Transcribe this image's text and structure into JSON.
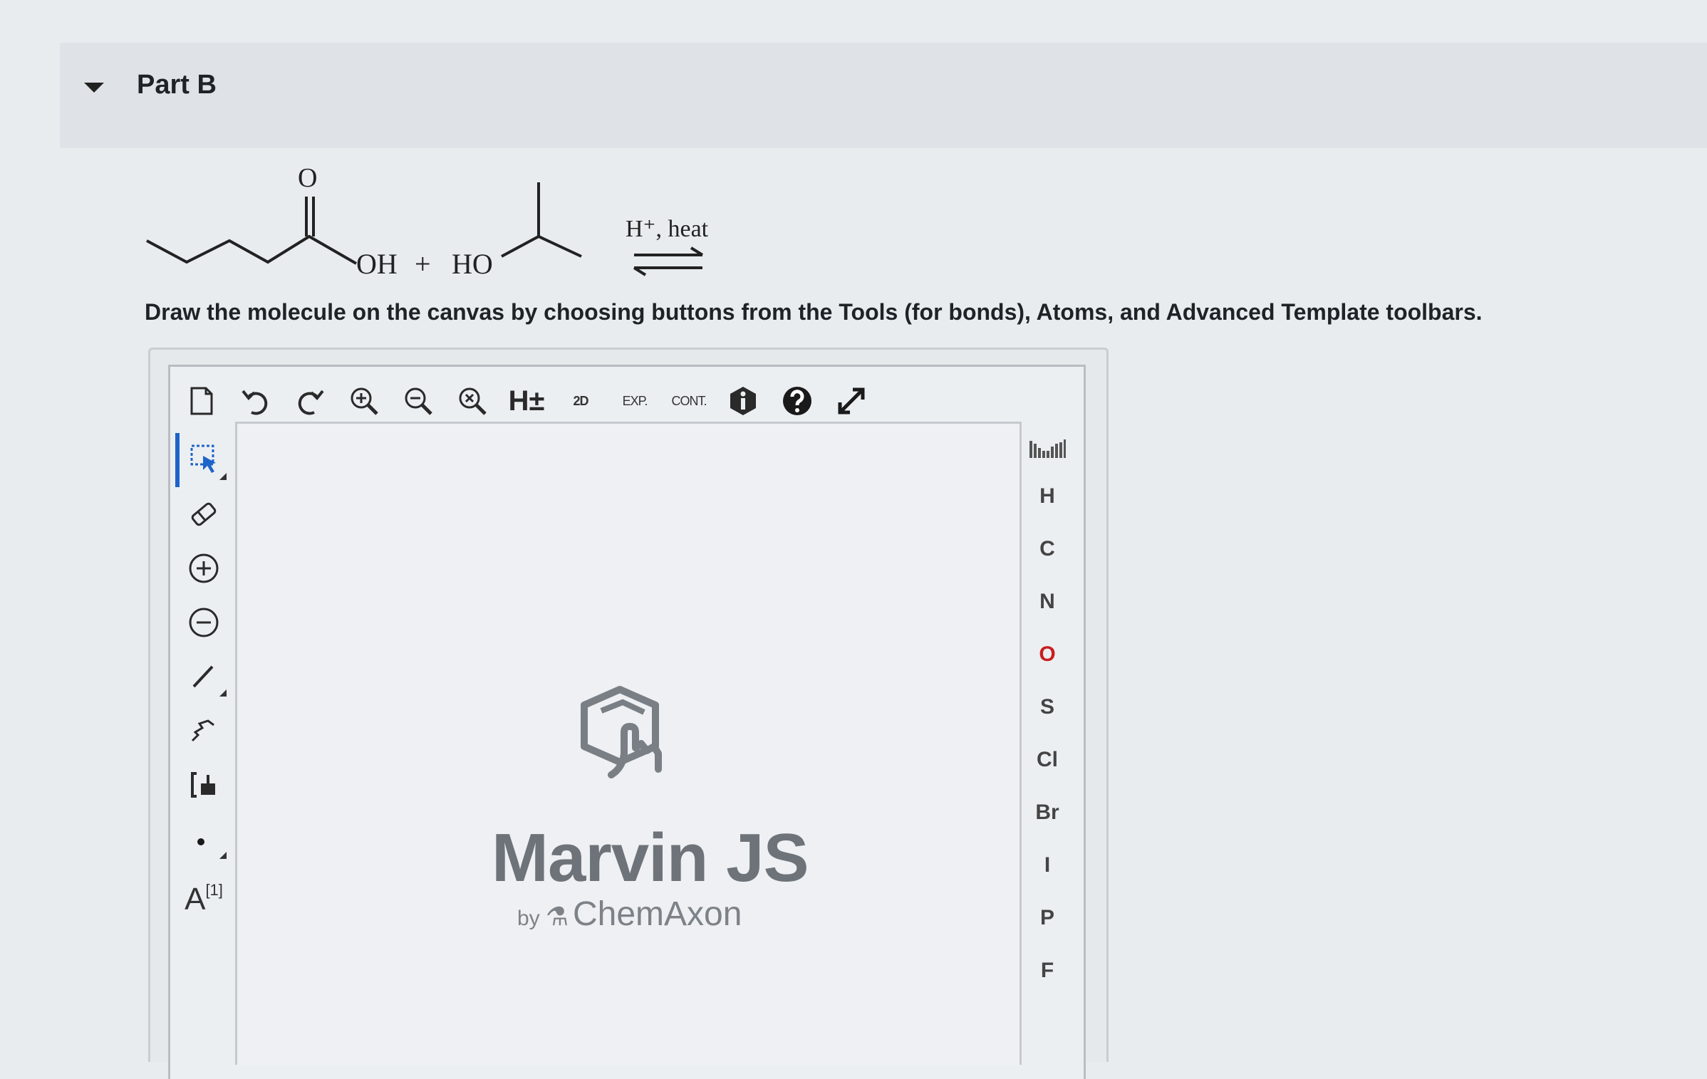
{
  "part": {
    "title": "Part B"
  },
  "reaction": {
    "carbonyl_o": "O",
    "oh": "OH",
    "plus": "+",
    "ho": "HO",
    "conditions": "H⁺, heat"
  },
  "instructions": "Draw the molecule on the canvas by choosing buttons from the Tools (for bonds), Atoms, and Advanced Template toolbars.",
  "top_toolbar": [
    {
      "name": "new-document-icon"
    },
    {
      "name": "undo-icon"
    },
    {
      "name": "redo-icon"
    },
    {
      "name": "zoom-in-icon"
    },
    {
      "name": "zoom-out-icon"
    },
    {
      "name": "zoom-reset-icon"
    },
    {
      "name": "hydrogen-toggle",
      "label": "H±"
    },
    {
      "name": "clean-2d",
      "label": "2D"
    },
    {
      "name": "expand-group",
      "label": "EXP."
    },
    {
      "name": "contract-group",
      "label": "CONT."
    },
    {
      "name": "info-icon"
    },
    {
      "name": "help-icon"
    },
    {
      "name": "fullscreen-icon"
    }
  ],
  "left_toolbar": [
    {
      "name": "select-tool-icon"
    },
    {
      "name": "eraser-icon"
    },
    {
      "name": "charge-plus-icon"
    },
    {
      "name": "charge-minus-icon"
    },
    {
      "name": "single-bond-icon"
    },
    {
      "name": "chain-icon"
    },
    {
      "name": "bracket-icon"
    },
    {
      "name": "radical-icon"
    },
    {
      "name": "atom-map-icon",
      "label": "A",
      "sup": "[1]"
    }
  ],
  "atoms": [
    "H",
    "C",
    "N",
    "O",
    "S",
    "Cl",
    "Br",
    "I",
    "P",
    "F"
  ],
  "canvas_logo": {
    "title": "Marvin JS",
    "by": "by",
    "brand": "ChemAxon"
  },
  "colors": {
    "active_tool": "#1e64c8",
    "oxygen": "#c81e1e"
  }
}
